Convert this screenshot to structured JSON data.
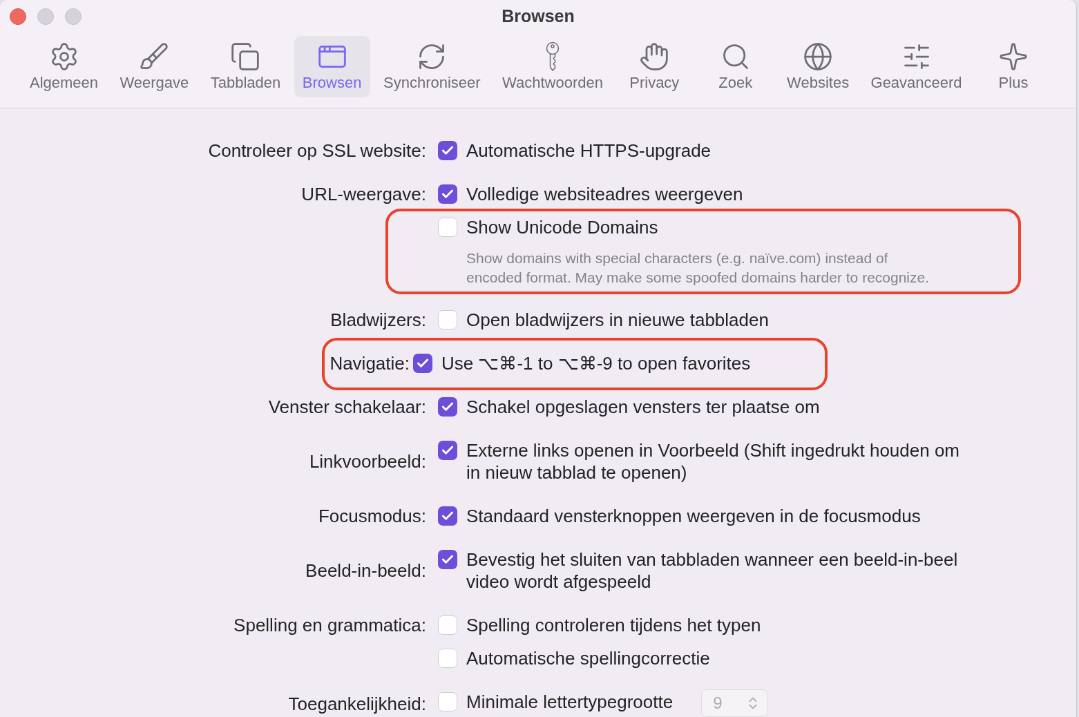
{
  "window": {
    "title": "Browsen"
  },
  "toolbar": [
    {
      "label": "Algemeen",
      "selected": false
    },
    {
      "label": "Weergave",
      "selected": false
    },
    {
      "label": "Tabbladen",
      "selected": false
    },
    {
      "label": "Browsen",
      "selected": true
    },
    {
      "label": "Synchroniseer",
      "selected": false
    },
    {
      "label": "Wachtwoorden",
      "selected": false
    },
    {
      "label": "Privacy",
      "selected": false
    },
    {
      "label": "Zoek",
      "selected": false
    },
    {
      "label": "Websites",
      "selected": false
    },
    {
      "label": "Geavanceerd",
      "selected": false
    },
    {
      "label": "Plus",
      "selected": false
    }
  ],
  "sections": [
    {
      "kind": "standard",
      "label": "Controleer op SSL website:",
      "options": [
        {
          "text": "Automatische HTTPS-upgrade",
          "checked": true,
          "highlighted": false
        }
      ]
    },
    {
      "kind": "standard",
      "label": "URL-weergave:",
      "options": [
        {
          "text": "Volledige websiteadres weergeven",
          "checked": true,
          "highlighted": false
        },
        {
          "text": "Show Unicode Domains",
          "checked": false,
          "highlighted": true,
          "description": "Show domains with special characters (e.g. naïve.com) instead of\nencoded format. May make some spoofed domains harder to recognize."
        }
      ]
    },
    {
      "kind": "standard",
      "label": "Bladwijzers:",
      "options": [
        {
          "text": "Open bladwijzers in nieuwe tabbladen",
          "checked": false,
          "highlighted": false
        }
      ]
    },
    {
      "kind": "overlapping",
      "label": "Navigatie:",
      "options": [
        {
          "text": "Use ⌥⌘-1 to ⌥⌘-9 to open favorites",
          "checked": true,
          "highlighted": true
        }
      ]
    },
    {
      "kind": "standard",
      "label": "Venster schakelaar:",
      "options": [
        {
          "text": "Schakel opgeslagen vensters ter plaatse om",
          "checked": true,
          "highlighted": false
        }
      ]
    },
    {
      "kind": "standard",
      "label": "Linkvoorbeeld:",
      "options": [
        {
          "text": "Externe links openen in Voorbeeld (Shift ingedrukt houden om\nin nieuw tabblad te openen)",
          "checked": true,
          "highlighted": false
        }
      ]
    },
    {
      "kind": "standard",
      "label": "Focusmodus:",
      "options": [
        {
          "text": "Standaard vensterknoppen weergeven in de focusmodus",
          "checked": true,
          "highlighted": false
        }
      ]
    },
    {
      "kind": "standard",
      "label": "Beeld-in-beeld:",
      "options": [
        {
          "text": "Bevestig het sluiten van tabbladen wanneer een beeld-in-beel\nvideo wordt afgespeeld",
          "checked": true,
          "highlighted": false
        }
      ]
    },
    {
      "kind": "standard",
      "label": "Spelling en grammatica:",
      "options": [
        {
          "text": "Spelling controleren tijdens het typen",
          "checked": false,
          "highlighted": false
        },
        {
          "text": "Automatische spellingcorrectie",
          "checked": false,
          "highlighted": false
        }
      ]
    },
    {
      "kind": "standard",
      "label": "Toegankelijkheid:",
      "options": [
        {
          "text": "Minimale lettertypegrootte",
          "checked": false,
          "highlighted": false,
          "stepper": {
            "value": "9",
            "disabled": true
          }
        }
      ]
    }
  ]
}
